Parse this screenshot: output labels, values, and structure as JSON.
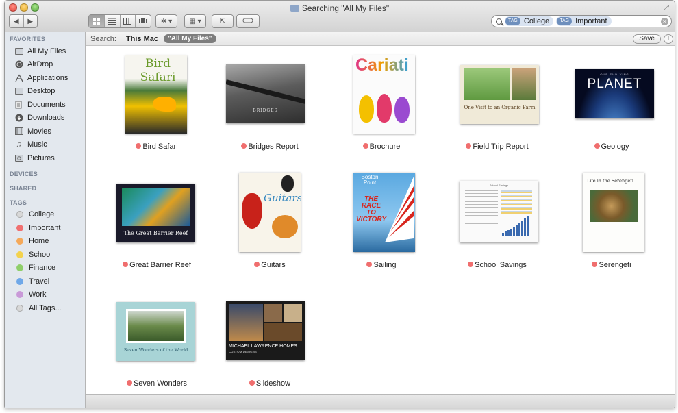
{
  "window": {
    "title": "Searching \"All My Files\""
  },
  "toolbar": {
    "back_icon": "back-arrow-icon",
    "forward_icon": "forward-arrow-icon",
    "view_modes": [
      "icon-view",
      "list-view",
      "column-view",
      "coverflow-view"
    ],
    "action_icon": "gear-icon",
    "arrange_icon": "arrange-grid-icon",
    "share_icon": "share-icon",
    "tags_icon": "tags-icon"
  },
  "search": {
    "tokens": [
      {
        "tag": "TAG",
        "value": "College"
      },
      {
        "tag": "TAG",
        "value": "Important"
      }
    ]
  },
  "scope": {
    "label": "Search:",
    "this_mac": "This Mac",
    "all_my_files": "\"All My Files\"",
    "save": "Save",
    "plus": "+"
  },
  "sidebar": {
    "favorites_heading": "FAVORITES",
    "favorites": [
      {
        "label": "All My Files",
        "icon": "all-my-files-icon"
      },
      {
        "label": "AirDrop",
        "icon": "airdrop-icon"
      },
      {
        "label": "Applications",
        "icon": "applications-icon"
      },
      {
        "label": "Desktop",
        "icon": "desktop-icon"
      },
      {
        "label": "Documents",
        "icon": "documents-icon"
      },
      {
        "label": "Downloads",
        "icon": "downloads-icon"
      },
      {
        "label": "Movies",
        "icon": "movies-icon"
      },
      {
        "label": "Music",
        "icon": "music-icon"
      },
      {
        "label": "Pictures",
        "icon": "pictures-icon"
      }
    ],
    "devices_heading": "DEVICES",
    "shared_heading": "SHARED",
    "tags_heading": "TAGS",
    "tags": [
      {
        "label": "College",
        "color": "#d8d8d8"
      },
      {
        "label": "Important",
        "color": "#f07070"
      },
      {
        "label": "Home",
        "color": "#f5a95a"
      },
      {
        "label": "School",
        "color": "#f3d24d"
      },
      {
        "label": "Finance",
        "color": "#8fcf6a"
      },
      {
        "label": "Travel",
        "color": "#6fa8e8"
      },
      {
        "label": "Work",
        "color": "#c99ad8"
      },
      {
        "label": "All Tags...",
        "color": "#d8d8d8"
      }
    ]
  },
  "files": [
    {
      "name": "Bird Safari",
      "thumb_text": "Bird Safari"
    },
    {
      "name": "Bridges Report",
      "thumb_text": "BRIDGES"
    },
    {
      "name": "Brochure",
      "thumb_text": "Cariati"
    },
    {
      "name": "Field Trip Report",
      "thumb_text": "One Visit to an Organic Farm"
    },
    {
      "name": "Geology",
      "thumb_text": "PLANET",
      "thumb_sub": "OUR EVOLVING"
    },
    {
      "name": "Great Barrier Reef",
      "thumb_text": "The Great Barrier Reef"
    },
    {
      "name": "Guitars",
      "thumb_text": "Guitars"
    },
    {
      "name": "Sailing",
      "thumb_text": "THE RACE TO VICTORY",
      "thumb_sub": "Boston Point"
    },
    {
      "name": "School Savings",
      "thumb_text": "School Savings"
    },
    {
      "name": "Serengeti",
      "thumb_text": "Life in the Serengeti"
    },
    {
      "name": "Seven Wonders",
      "thumb_text": "Seven Wonders of the World"
    },
    {
      "name": "Slideshow",
      "thumb_text": "MICHAEL LAWRENCE HOMES",
      "thumb_sub": "CUSTOM DESIGNS"
    }
  ],
  "colors": {
    "tag_important": "#f06e6e",
    "sidebar_bg": "#e3e8ee"
  }
}
